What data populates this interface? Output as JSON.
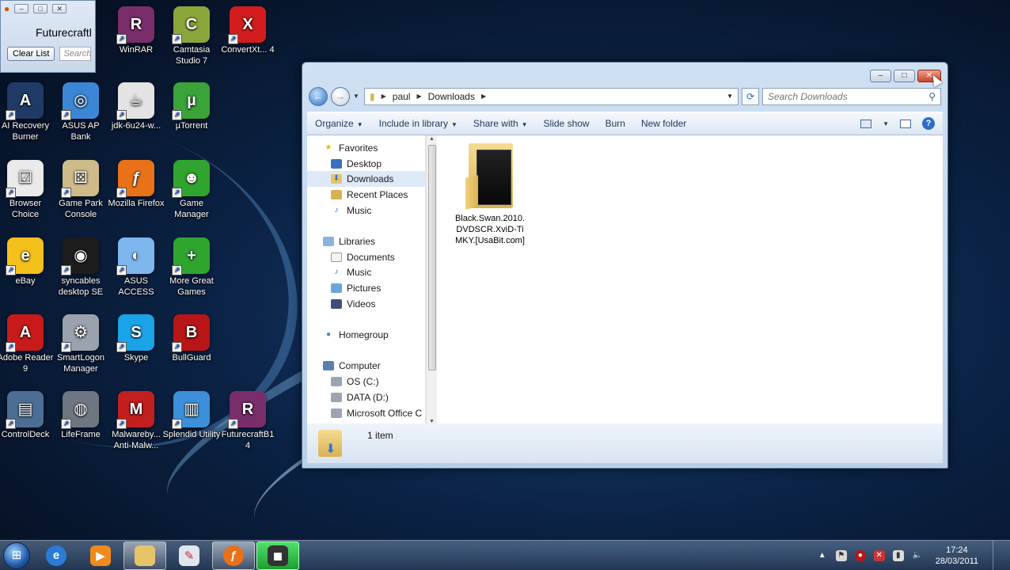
{
  "desktop_icons": [
    {
      "label": "WinRAR",
      "icon": "winrar-icon",
      "color": "#7a2d6b",
      "glyph": "R"
    },
    {
      "label": "Camtasia Studio 7",
      "icon": "camtasia-icon",
      "color": "#8aa63b",
      "glyph": "C"
    },
    {
      "label": "ConvertXt... 4",
      "icon": "convertx-icon",
      "color": "#d11d1d",
      "glyph": "X"
    },
    {
      "label": "AI Recovery Burner",
      "icon": "ai-recovery-icon",
      "color": "#203a66",
      "glyph": "A"
    },
    {
      "label": "ASUS AP Bank",
      "icon": "asus-ap-bank-icon",
      "color": "#3b87d6",
      "glyph": "◎"
    },
    {
      "label": "jdk-6u24-w...",
      "icon": "java-icon",
      "color": "#e3e3e3",
      "glyph": "☕"
    },
    {
      "label": "µTorrent",
      "icon": "utorrent-icon",
      "color": "#3aa33a",
      "glyph": "µ"
    },
    {
      "label": "Browser Choice",
      "icon": "browser-choice-icon",
      "color": "#eaeaea",
      "glyph": "☑"
    },
    {
      "label": "Game Park Console",
      "icon": "game-park-icon",
      "color": "#cdbb8a",
      "glyph": "⚄"
    },
    {
      "label": "Mozilla Firefox",
      "icon": "firefox-icon",
      "color": "#e8711a",
      "glyph": "ƒ"
    },
    {
      "label": "Game Manager",
      "icon": "game-manager-icon",
      "color": "#2fa52f",
      "glyph": "☻"
    },
    {
      "label": "eBay",
      "icon": "ebay-icon",
      "color": "#f4c01b",
      "glyph": "e"
    },
    {
      "label": "syncables desktop SE",
      "icon": "syncables-icon",
      "color": "#1d1d1d",
      "glyph": "◉"
    },
    {
      "label": "ASUS ACCESS",
      "icon": "asus-access-icon",
      "color": "#7db7ee",
      "glyph": "◐"
    },
    {
      "label": "More Great Games",
      "icon": "more-games-icon",
      "color": "#2fa52f",
      "glyph": "+"
    },
    {
      "label": "Adobe Reader 9",
      "icon": "adobe-reader-icon",
      "color": "#c81a1a",
      "glyph": "A"
    },
    {
      "label": "SmartLogon Manager",
      "icon": "smartlogon-icon",
      "color": "#9aa2ad",
      "glyph": "⚙"
    },
    {
      "label": "Skype",
      "icon": "skype-icon",
      "color": "#1aa3e6",
      "glyph": "S"
    },
    {
      "label": "BullGuard",
      "icon": "bullguard-icon",
      "color": "#b81616",
      "glyph": "B"
    },
    {
      "label": "ControlDeck",
      "icon": "controldeck-icon",
      "color": "#4d6e94",
      "glyph": "▤"
    },
    {
      "label": "LifeFrame",
      "icon": "lifeframe-icon",
      "color": "#6e7781",
      "glyph": "◍"
    },
    {
      "label": "Malwareby... Anti-Malw...",
      "icon": "malwarebytes-icon",
      "color": "#c21f1f",
      "glyph": "M"
    },
    {
      "label": "Splendid Utility",
      "icon": "splendid-icon",
      "color": "#3c8fd8",
      "glyph": "▥"
    },
    {
      "label": "FuturecraftB1 4",
      "icon": "futurecraft-icon",
      "color": "#7a2d6b",
      "glyph": "R"
    }
  ],
  "mini_window": {
    "title": "Futurecraftl",
    "clear_label": "Clear List",
    "search_placeholder": "Search"
  },
  "explorer": {
    "breadcrumb": [
      "paul",
      "Downloads"
    ],
    "search_placeholder": "Search Downloads",
    "commands": [
      "Organize",
      "Include in library",
      "Share with",
      "Slide show",
      "Burn",
      "New folder"
    ],
    "nav": {
      "favorites_label": "Favorites",
      "favorites": [
        "Desktop",
        "Downloads",
        "Recent Places",
        "Music"
      ],
      "libraries_label": "Libraries",
      "libraries": [
        "Documents",
        "Music",
        "Pictures",
        "Videos"
      ],
      "homegroup_label": "Homegroup",
      "computer_label": "Computer",
      "drives": [
        "OS (C:)",
        "DATA (D:)",
        "Microsoft Office C"
      ]
    },
    "file": {
      "name": "Black.Swan.2010.DVDSCR.XviD-TiMKY.[UsaBit.com]"
    },
    "status_text": "1 item"
  },
  "taskbar": {
    "time": "17:24",
    "date": "28/03/2011"
  }
}
